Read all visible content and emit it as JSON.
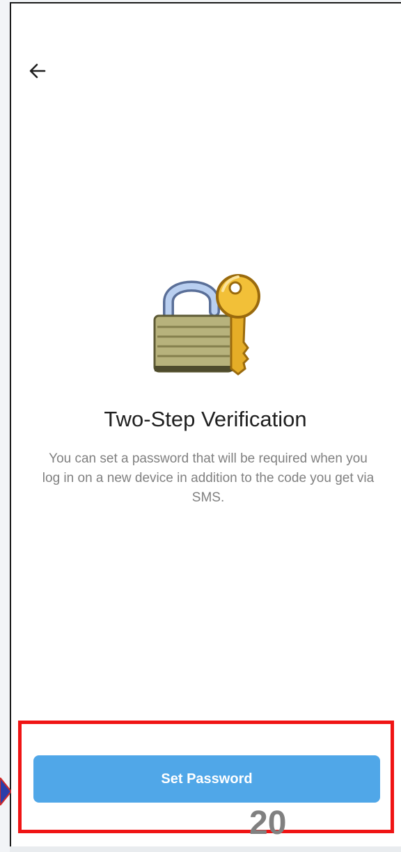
{
  "screen": {
    "title": "Two-Step Verification",
    "description": "You can set a password that will be required when you log in on a new device in addition to the code you get via SMS."
  },
  "icons": {
    "back": "arrow-left-icon",
    "illustration": "padlock-with-key-icon",
    "pointer": "pointer-arrow-icon"
  },
  "actions": {
    "primary_label": "Set Password"
  },
  "annotation": {
    "step_number": "20"
  },
  "colors": {
    "button": "#50a7e8",
    "highlight": "#f01414",
    "step_number": "#808080",
    "pointer": "#2b3da8"
  }
}
